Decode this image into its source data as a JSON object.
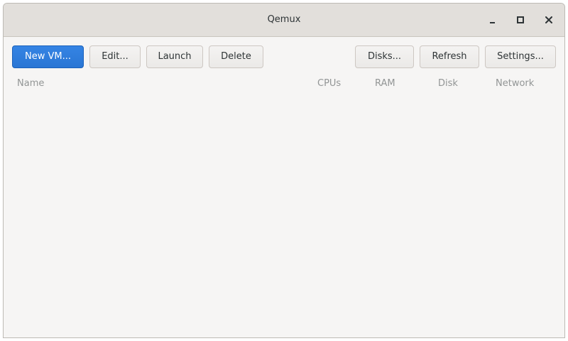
{
  "window": {
    "title": "Qemux"
  },
  "window_controls": {
    "minimize_icon": "minimize-icon",
    "maximize_icon": "maximize-icon",
    "close_icon": "close-icon"
  },
  "toolbar": {
    "new_vm_label": "New VM...",
    "edit_label": "Edit...",
    "launch_label": "Launch",
    "delete_label": "Delete",
    "disks_label": "Disks...",
    "refresh_label": "Refresh",
    "settings_label": "Settings..."
  },
  "vm_list": {
    "columns": [
      "Name",
      "CPUs",
      "RAM",
      "Disk",
      "Network"
    ],
    "rows": []
  },
  "colors": {
    "accent": "#3584e4",
    "header_text": "#929595",
    "background": "#f6f5f4",
    "titlebar": "#e2dfdb"
  }
}
